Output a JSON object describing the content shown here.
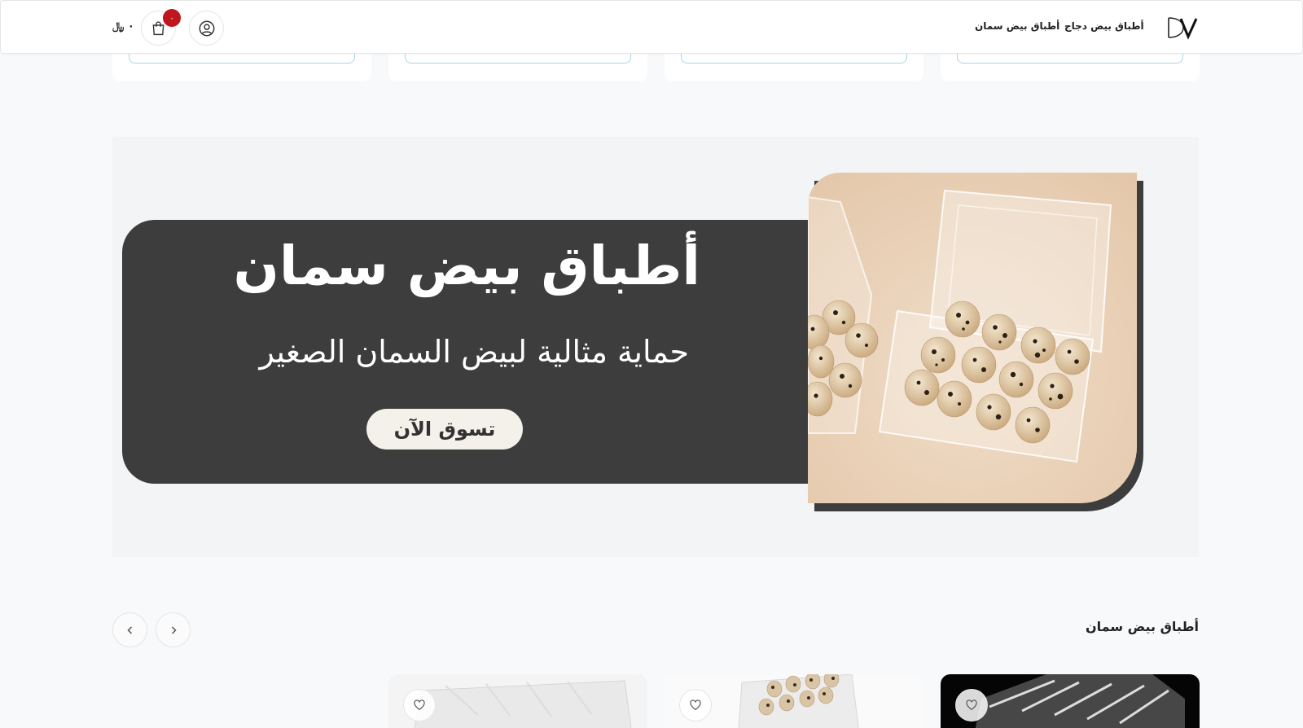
{
  "header": {
    "logo_text": "DV",
    "nav": [
      {
        "label": "أطباق بيض دجاج"
      },
      {
        "label": "أطباق بيض سمان"
      }
    ],
    "cart_badge": "٠",
    "cart_total": "٠ ﷼"
  },
  "banner": {
    "title": "أطباق بيض سمان",
    "subtitle": "حماية مثالية لبيض السمان الصغير",
    "cta_label": "تسوق الآن"
  },
  "section": {
    "title": "أطباق بيض سمان"
  },
  "icons": {
    "account": "user-circle-icon",
    "cart": "shopping-bag-icon",
    "prev": "chevron-left-icon",
    "next": "chevron-right-icon",
    "favorite": "heart-icon"
  },
  "colors": {
    "dark_panel": "#3d3d3d",
    "badge": "#c0161e",
    "accent_border": "#a8d5e6",
    "photo_bg": "#ecd5bf"
  }
}
